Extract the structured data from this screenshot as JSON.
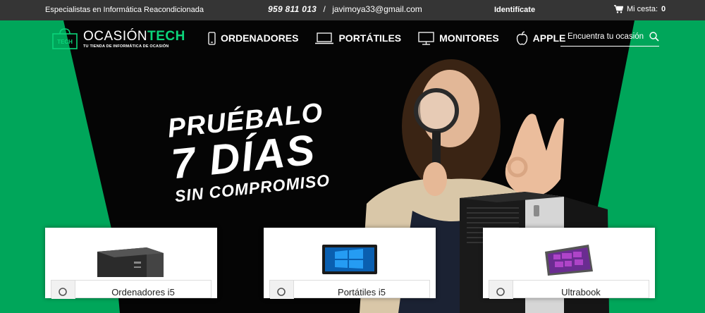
{
  "topbar": {
    "tagline": "Especialistas en Informática Reacondicionada",
    "phone": "959 811 013",
    "separator": "/",
    "email": "javimoya33@gmail.com",
    "login": "Identifícate",
    "cart_label": "Mi cesta:",
    "cart_count": "0"
  },
  "logo": {
    "name_light": "OCASIÓN",
    "name_bold": "TECH",
    "tagline": "TU TIENDA DE INFORMÁTICA DE OCASIÓN",
    "bag_text": "TECH"
  },
  "nav": {
    "items": [
      {
        "label": "ORDENADORES",
        "icon": "phone-desktop-icon"
      },
      {
        "label": "PORTÁTILES",
        "icon": "laptop-icon"
      },
      {
        "label": "MONITORES",
        "icon": "monitor-icon"
      },
      {
        "label": "APPLE",
        "icon": "apple-icon"
      }
    ]
  },
  "search": {
    "placeholder": "Encuentra tu ocasión..."
  },
  "hero": {
    "line1": "PRUÉBALO",
    "line2": "7 DÍAS",
    "line3": "SIN COMPROMISO"
  },
  "cards": [
    {
      "label": "Ordenadores i5"
    },
    {
      "label": "Portátiles i5"
    },
    {
      "label": "Ultrabook"
    }
  ],
  "colors": {
    "accent_green": "#00a65a",
    "topbar": "#353535",
    "hero_black": "#050505"
  }
}
